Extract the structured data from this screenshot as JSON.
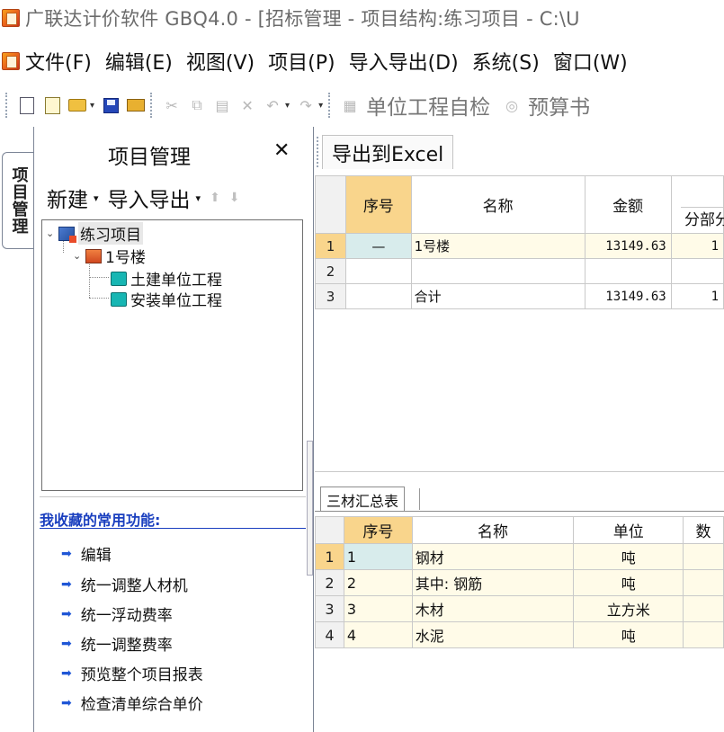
{
  "window": {
    "title": "广联达计价软件 GBQ4.0 - [招标管理 - 项目结构:练习项目 - C:\\U"
  },
  "menu": [
    "文件(F)",
    "编辑(E)",
    "视图(V)",
    "项目(P)",
    "导入导出(D)",
    "系统(S)",
    "窗口(W)"
  ],
  "toolbar": {
    "check_label": "单位工程自检",
    "budget_label": "预算书"
  },
  "left_panel": {
    "vertical_tab": "项目管理",
    "title": "项目管理",
    "close": "✕",
    "new_label": "新建",
    "import_export_label": "导入导出",
    "tree": {
      "root": "练习项目",
      "building": "1号楼",
      "units": [
        "土建单位工程",
        "安装单位工程"
      ]
    },
    "favorites_title": "我收藏的常用功能:",
    "favorites": [
      "编辑",
      "统一调整人材机",
      "统一浮动费率",
      "统一调整费率",
      "预览整个项目报表",
      "检查清单综合单价"
    ]
  },
  "right_panel": {
    "tab_label": "导出到Excel",
    "summary_table": {
      "headers": [
        "序号",
        "名称",
        "金额",
        "分部分"
      ],
      "rows": [
        {
          "rn": "1",
          "seq": "—",
          "name": "1号楼",
          "amount": "13149.63",
          "extra": "1"
        },
        {
          "rn": "2",
          "seq": "",
          "name": "",
          "amount": "",
          "extra": ""
        },
        {
          "rn": "3",
          "seq": "",
          "name": "合计",
          "amount": "13149.63",
          "extra": "1"
        }
      ]
    },
    "materials_tab": "三材汇总表",
    "materials_table": {
      "headers": [
        "序号",
        "名称",
        "单位",
        "数"
      ],
      "rows": [
        {
          "rn": "1",
          "seq": "1",
          "name": "钢材",
          "unit": "吨"
        },
        {
          "rn": "2",
          "seq": "2",
          "name": "其中: 钢筋",
          "unit": "吨"
        },
        {
          "rn": "3",
          "seq": "3",
          "name": "木材",
          "unit": "立方米"
        },
        {
          "rn": "4",
          "seq": "4",
          "name": "水泥",
          "unit": "吨"
        }
      ]
    }
  },
  "colors": {
    "header_highlight": "#f9d58c",
    "row_highlight": "#fffbe8",
    "selected_cell": "#d8ecec",
    "link_blue": "#1a3fbf"
  }
}
